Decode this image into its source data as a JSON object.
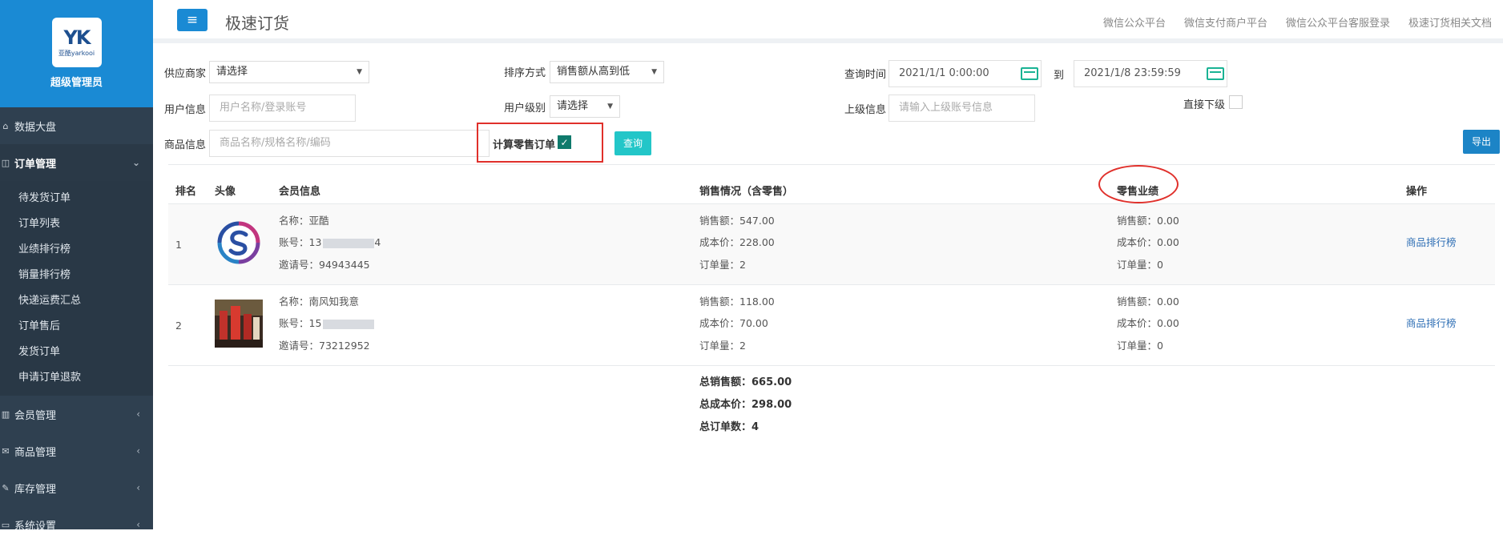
{
  "brand": {
    "logo_mark": "YK",
    "logo_text": "亚酷yarkooi",
    "title": "超级管理员"
  },
  "sidebar": {
    "items": [
      {
        "label": "数据大盘",
        "icon": "dashboard-icon"
      },
      {
        "label": "订单管理",
        "icon": "order-icon",
        "expanded": true,
        "children": [
          "待发货订单",
          "订单列表",
          "业绩排行榜",
          "销量排行榜",
          "快递运费汇总",
          "订单售后",
          "发货订单",
          "申请订单退款"
        ]
      },
      {
        "label": "会员管理",
        "icon": "chart-icon"
      },
      {
        "label": "商品管理",
        "icon": "mail-icon"
      },
      {
        "label": "库存管理",
        "icon": "edit-icon"
      },
      {
        "label": "系统设置",
        "icon": "monitor-icon"
      }
    ]
  },
  "header": {
    "title": "极速订货",
    "links": [
      "微信公众平台",
      "微信支付商户平台",
      "微信公众平台客服登录",
      "极速订货相关文档"
    ]
  },
  "filters": {
    "supplier_label": "供应商家",
    "supplier_value": "请选择",
    "sort_label": "排序方式",
    "sort_value": "销售额从高到低",
    "time_label": "查询时间",
    "time_start": "2021/1/1 0:00:00",
    "time_to": "到",
    "time_end": "2021/1/8 23:59:59",
    "user_label": "用户信息",
    "user_placeholder": "用户名称/登录账号",
    "level_label": "用户级别",
    "level_value": "请选择",
    "parent_label": "上级信息",
    "parent_placeholder": "请输入上级账号信息",
    "direct_label": "直接下级",
    "product_label": "商品信息",
    "product_placeholder": "商品名称/规格名称/编码",
    "retail_label": "计算零售订单",
    "retail_checked": true,
    "query_button": "查询",
    "export_button": "导出"
  },
  "table": {
    "headers": [
      "排名",
      "头像",
      "会员信息",
      "销售情况（含零售）",
      "零售业绩",
      "操作"
    ],
    "rows": [
      {
        "rank": "1",
        "name": "名称：亚酷",
        "account_prefix": "账号：13",
        "account_suffix": "4",
        "invite": "邀请号：94943445",
        "sales": "销售额：547.00",
        "cost": "成本价：228.00",
        "orders": "订单量：2",
        "r_sales": "销售额：0.00",
        "r_cost": "成本价：0.00",
        "r_orders": "订单量：0",
        "action": "商品排行榜"
      },
      {
        "rank": "2",
        "name": "名称：南风知我意",
        "account_prefix": "账号：15",
        "account_suffix": "",
        "invite": "邀请号：73212952",
        "sales": "销售额：118.00",
        "cost": "成本价：70.00",
        "orders": "订单量：2",
        "r_sales": "销售额：0.00",
        "r_cost": "成本价：0.00",
        "r_orders": "订单量：0",
        "action": "商品排行榜"
      }
    ],
    "totals": {
      "sales": "总销售额：665.00",
      "cost": "总成本价：298.00",
      "orders": "总订单数：4"
    }
  },
  "colors": {
    "sidebar": "#2f4050",
    "brand": "#1a8ad4",
    "accent": "#23c6c8",
    "export": "#1c84c6",
    "highlight": "#e0302b"
  }
}
